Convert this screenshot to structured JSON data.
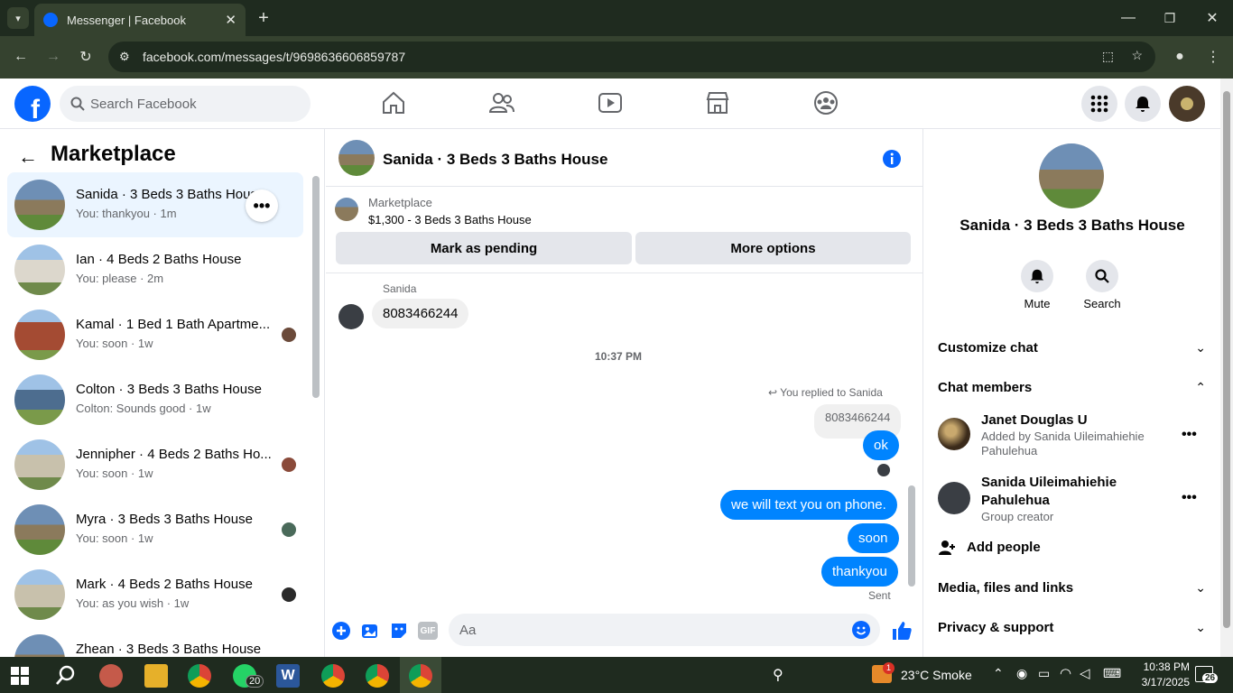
{
  "browser": {
    "tab_title": "Messenger | Facebook",
    "url": "facebook.com/messages/t/9698636606859787"
  },
  "header": {
    "search_placeholder": "Search Facebook"
  },
  "left_panel": {
    "title": "Marketplace",
    "conversations": [
      {
        "title": "Sanida · 3 Beds 3 Baths House",
        "subtitle": "You: thankyou · 1m"
      },
      {
        "title": "Ian · 4 Beds 2 Baths House",
        "subtitle": "You: please · 2m"
      },
      {
        "title": "Kamal · 1 Bed 1 Bath Apartme...",
        "subtitle": "You: soon · 1w"
      },
      {
        "title": "Colton · 3 Beds 3 Baths House",
        "subtitle": "Colton: Sounds good · 1w"
      },
      {
        "title": "Jennipher · 4 Beds 2 Baths Ho...",
        "subtitle": "You: soon · 1w"
      },
      {
        "title": "Myra · 3 Beds 3 Baths House",
        "subtitle": "You: soon · 1w"
      },
      {
        "title": "Mark · 4 Beds 2 Baths House",
        "subtitle": "You: as you wish · 1w"
      },
      {
        "title": "Zhean · 3 Beds 3 Baths House",
        "subtitle": ""
      }
    ]
  },
  "chat": {
    "title": "Sanida · 3 Beds 3 Baths House",
    "listing_label": "Marketplace",
    "listing_price": "$1,300 - 3 Beds 3 Baths House",
    "mark_pending": "Mark as pending",
    "more_options": "More options",
    "sender_name": "Sanida",
    "incoming_message": "8083466244",
    "timestamp": "10:37 PM",
    "replied_label": "You replied to Sanida",
    "quoted_text": "8083466244",
    "outgoing": [
      "ok",
      "we will text you on phone.",
      "soon",
      "thankyou"
    ],
    "status": "Sent",
    "composer_placeholder": "Aa"
  },
  "right_panel": {
    "name": "Sanida · 3 Beds 3 Baths House",
    "mute_label": "Mute",
    "search_label": "Search",
    "customize": "Customize chat",
    "members_title": "Chat members",
    "members": [
      {
        "name": "Janet Douglas U",
        "detail": "Added by Sanida Uileimahiehie Pahulehua"
      },
      {
        "name": "Sanida Uileimahiehie Pahulehua",
        "detail": "Group creator"
      }
    ],
    "add_people": "Add people",
    "media": "Media, files and links",
    "privacy": "Privacy & support"
  },
  "taskbar": {
    "weather": "23°C  Smoke",
    "time": "10:38 PM",
    "date": "3/17/2025",
    "whatsapp_badge": "20",
    "weather_badge": "1",
    "notif_count": "26"
  },
  "colors": {
    "fb_blue": "#0866ff",
    "messenger_blue": "#0084ff"
  }
}
